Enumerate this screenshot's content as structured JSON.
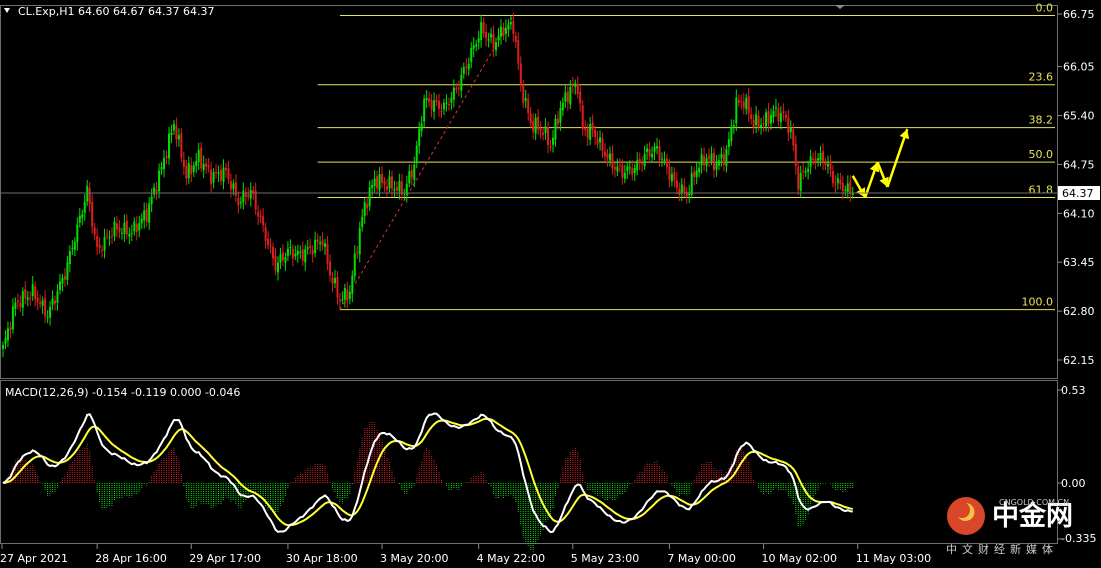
{
  "header": {
    "symbol_line": "CL.Exp,H1  64.60 64.67 64.37 64.37",
    "macd_line": "MACD(12,26,9) -0.154 -0.119 0.000 -0.046"
  },
  "colors": {
    "background": "#000000",
    "bull": "#00e000",
    "bear": "#e01e1e",
    "fib": "#e8e35a",
    "macd": "#ffffff",
    "signal": "#ffff33",
    "arrows": "#ffff00"
  },
  "chart_data": [
    {
      "type": "candlestick",
      "title": "CL.Exp,H1",
      "ohlc_header": {
        "open": 64.6,
        "high": 64.67,
        "low": 64.37,
        "close": 64.37
      },
      "current_price": "64.37",
      "y_ticks": [
        "66.75",
        "66.05",
        "65.40",
        "64.75",
        "64.10",
        "63.45",
        "62.80",
        "62.15"
      ],
      "ylim": [
        61.85,
        66.95
      ],
      "x_ticks": [
        "27 Apr 2021",
        "28 Apr 16:00",
        "29 Apr 17:00",
        "30 Apr 18:00",
        "3 May 20:00",
        "4 May 22:00",
        "5 May 23:00",
        "7 May 00:00",
        "10 May 02:00",
        "11 May 03:00"
      ],
      "fibonacci": {
        "high": 66.73,
        "low": 62.82,
        "levels": [
          {
            "label": "0.0",
            "price": 66.73
          },
          {
            "label": "23.6",
            "price": 65.81
          },
          {
            "label": "38.2",
            "price": 65.24
          },
          {
            "label": "50.0",
            "price": 64.78
          },
          {
            "label": "61.8",
            "price": 64.31
          },
          {
            "label": "100.0",
            "price": 62.82
          }
        ]
      },
      "keypoints": [
        [
          0,
          62.3
        ],
        [
          5,
          62.9
        ],
        [
          12,
          63.05
        ],
        [
          18,
          62.75
        ],
        [
          25,
          63.3
        ],
        [
          30,
          63.9
        ],
        [
          34,
          64.4
        ],
        [
          38,
          63.6
        ],
        [
          45,
          63.9
        ],
        [
          52,
          63.85
        ],
        [
          58,
          64.1
        ],
        [
          64,
          64.7
        ],
        [
          69,
          65.3
        ],
        [
          74,
          64.6
        ],
        [
          79,
          64.85
        ],
        [
          84,
          64.6
        ],
        [
          90,
          64.65
        ],
        [
          95,
          64.25
        ],
        [
          100,
          64.4
        ],
        [
          105,
          63.9
        ],
        [
          110,
          63.4
        ],
        [
          115,
          63.6
        ],
        [
          120,
          63.55
        ],
        [
          125,
          63.65
        ],
        [
          129,
          63.75
        ],
        [
          132,
          63.3
        ],
        [
          136,
          62.95
        ],
        [
          140,
          63.05
        ],
        [
          143,
          63.7
        ],
        [
          146,
          64.2
        ],
        [
          150,
          64.55
        ],
        [
          154,
          64.5
        ],
        [
          158,
          64.45
        ],
        [
          162,
          64.4
        ],
        [
          166,
          64.75
        ],
        [
          170,
          65.6
        ],
        [
          174,
          65.55
        ],
        [
          178,
          65.5
        ],
        [
          183,
          65.75
        ],
        [
          188,
          66.15
        ],
        [
          193,
          66.55
        ],
        [
          198,
          66.35
        ],
        [
          202,
          66.55
        ],
        [
          206,
          66.6
        ],
        [
          209,
          65.8
        ],
        [
          213,
          65.3
        ],
        [
          218,
          65.2
        ],
        [
          221,
          65.0
        ],
        [
          225,
          65.5
        ],
        [
          229,
          65.75
        ],
        [
          232,
          65.8
        ],
        [
          234,
          65.2
        ],
        [
          238,
          65.2
        ],
        [
          242,
          64.95
        ],
        [
          246,
          64.75
        ],
        [
          250,
          64.65
        ],
        [
          255,
          64.7
        ],
        [
          260,
          64.9
        ],
        [
          264,
          64.95
        ],
        [
          268,
          64.7
        ],
        [
          272,
          64.45
        ],
        [
          276,
          64.35
        ],
        [
          280,
          64.7
        ],
        [
          284,
          64.85
        ],
        [
          288,
          64.75
        ],
        [
          292,
          64.9
        ],
        [
          296,
          65.55
        ],
        [
          299,
          65.6
        ],
        [
          303,
          65.3
        ],
        [
          307,
          65.3
        ],
        [
          311,
          65.45
        ],
        [
          315,
          65.4
        ],
        [
          318,
          65.2
        ],
        [
          321,
          64.5
        ],
        [
          324,
          64.7
        ],
        [
          328,
          64.85
        ],
        [
          332,
          64.8
        ],
        [
          335,
          64.55
        ],
        [
          339,
          64.45
        ],
        [
          343,
          64.37
        ]
      ],
      "forecast_path": [
        [
          64.6,
          343
        ],
        [
          64.31,
          348
        ],
        [
          64.78,
          353
        ],
        [
          64.45,
          357
        ],
        [
          65.22,
          365
        ]
      ]
    },
    {
      "type": "macd",
      "title": "MACD(12,26,9)",
      "values": {
        "main": -0.154,
        "signal": -0.119,
        "histogram_zero": 0.0,
        "osma": -0.046
      },
      "y_ticks": [
        "0.53",
        "0.00",
        "-0.335"
      ],
      "ylim": [
        -0.34,
        0.55
      ]
    }
  ],
  "watermark": {
    "brand": "中金网",
    "sub": "中文财经新媒体",
    "domain": "CNGOLD.COM.CN"
  }
}
